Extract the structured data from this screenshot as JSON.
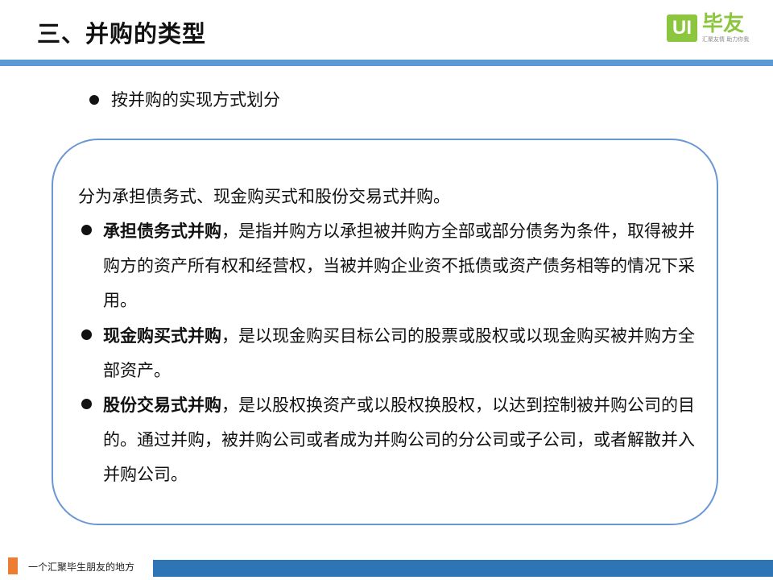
{
  "header": {
    "title": "三、并购的类型"
  },
  "logo": {
    "mark": "UI",
    "name": "毕友",
    "tagline": "汇聚友情  助力你我"
  },
  "subheading": "按并购的实现方式划分",
  "card": {
    "intro": "分为承担债务式、现金购买式和股份交易式并购。",
    "items": [
      {
        "term": "承担债务式并购",
        "text": "，是指并购方以承担被并购方全部或部分债务为条件，取得被并购方的资产所有权和经营权，当被并购企业资不抵债或资产债务相等的情况下采用。"
      },
      {
        "term": "现金购买式并购",
        "text": "，是以现金购买目标公司的股票或股权或以现金购买被并购方全部资产。"
      },
      {
        "term": "股份交易式并购",
        "text": "，是以股权换资产或以股权换股权，以达到控制被并购公司的目的。通过并购，被并购公司或者成为并购公司的分公司或子公司，或者解散并入并购公司。"
      }
    ]
  },
  "footer": {
    "text": "一个汇聚毕生朋友的地方"
  },
  "colors": {
    "accent_blue": "#5b9bd5",
    "footer_blue": "#2e75b6",
    "card_border": "#6a96d4",
    "logo_green": "#8cc63e",
    "footer_orange": "#ed7d31"
  }
}
